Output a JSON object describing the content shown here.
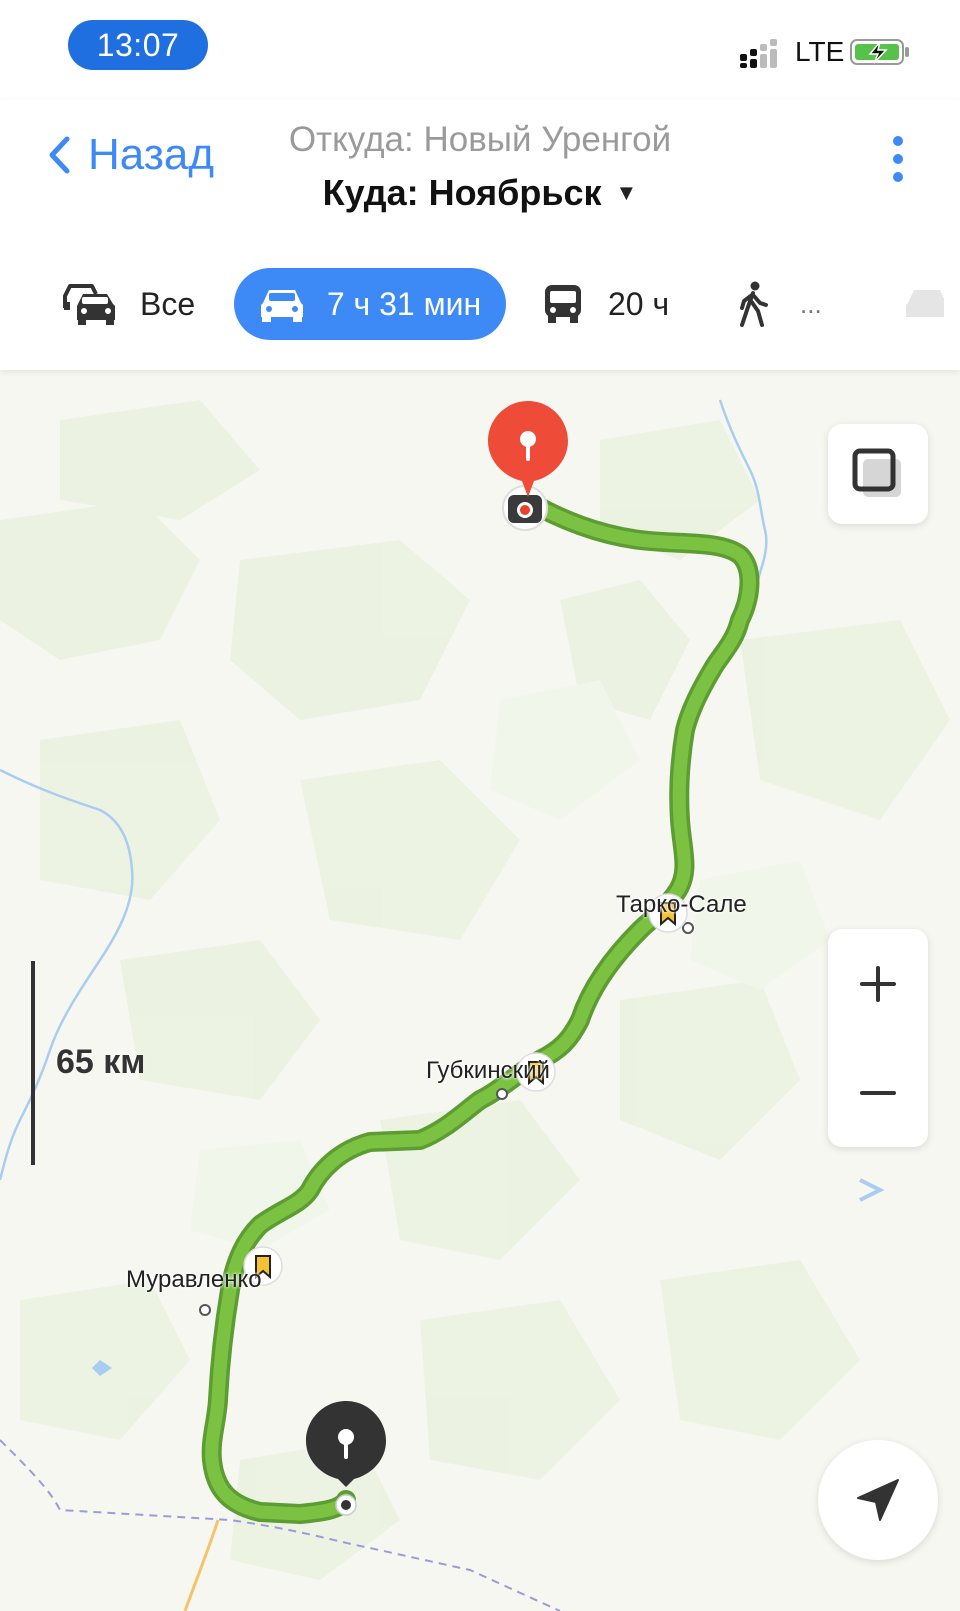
{
  "status_bar": {
    "time": "13:07",
    "network": "LTE"
  },
  "header": {
    "back_label": "Назад",
    "from": "Откуда: Новый Уренгой",
    "to": "Куда: Ноябрьск"
  },
  "modes": [
    {
      "label": "Все",
      "icon": "cars-icon"
    },
    {
      "label": "7 ч 31 мин",
      "icon": "car-icon",
      "active": true
    },
    {
      "label": "20 ч",
      "icon": "bus-icon"
    },
    {
      "label": "...",
      "icon": "walk-icon"
    }
  ],
  "map": {
    "towns": [
      "Тарко-Сале",
      "Губкинский",
      "Муравленко"
    ],
    "scale_label": "65 км",
    "route_color": "#7cc242",
    "destination_pin_color": "#ee4c39",
    "origin_pin_color": "#333333"
  }
}
